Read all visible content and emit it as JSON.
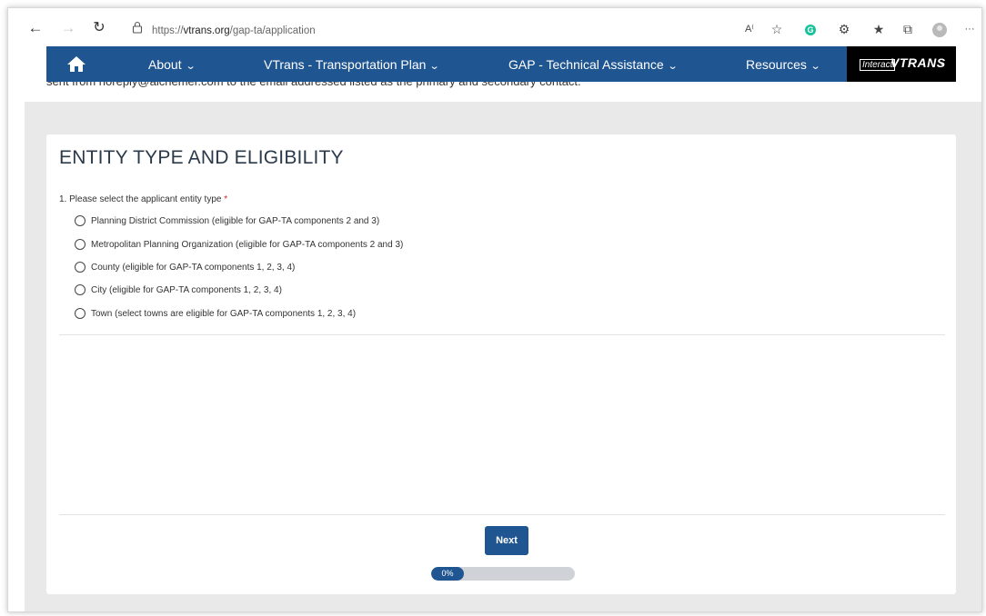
{
  "browser": {
    "url_prefix": "https://",
    "url_domain": "vtrans.org",
    "url_path": "/gap-ta/application",
    "toolbar_icons": [
      "read-aloud-icon",
      "favorite-star-icon",
      "grammarly-icon",
      "extensions-icon",
      "favorites-icon",
      "collections-icon",
      "profile-icon",
      "more-icon"
    ],
    "grammarly_letter": "G",
    "more_glyph": "···"
  },
  "nav": {
    "items": [
      {
        "label": "About"
      },
      {
        "label": "VTrans - Transportation Plan"
      },
      {
        "label": "GAP - Technical Assistance"
      },
      {
        "label": "Resources"
      }
    ],
    "brand_prefix": "Interact",
    "brand_name": "VTRANS",
    "accent_color": "#1f5591"
  },
  "background_text": "sent from noreply@alchemer.com to the email addressed listed as the primary and secondary contact.",
  "form": {
    "title": "ENTITY TYPE AND ELIGIBILITY",
    "question_label": "1. Please select the applicant entity type",
    "required_marker": "*",
    "options": [
      {
        "label": "Planning District Commission (eligible for GAP-TA components 2 and 3)"
      },
      {
        "label": "Metropolitan Planning Organization (eligible for GAP-TA components 2 and 3)"
      },
      {
        "label": "County (eligible for GAP-TA components 1, 2, 3, 4)"
      },
      {
        "label": "City (eligible for GAP-TA components 1, 2, 3, 4)"
      },
      {
        "label": "Town (select towns are eligible for GAP-TA components 1, 2, 3, 4)"
      }
    ],
    "next_label": "Next",
    "progress_label": "0%",
    "progress_value": 0
  }
}
